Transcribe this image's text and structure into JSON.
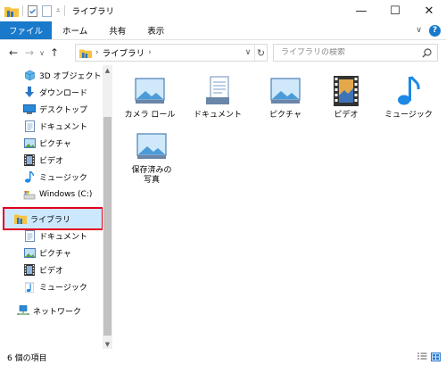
{
  "window": {
    "title": "ライブラリ",
    "minimize": "—",
    "maximize": "☐",
    "close": "✕"
  },
  "ribbon": {
    "tabs": [
      "ファイル",
      "ホーム",
      "共有",
      "表示"
    ],
    "expand": "∨",
    "help": "?"
  },
  "nav": {
    "back": "←",
    "forward": "→",
    "recent": "∨",
    "up": "↑",
    "dropdown": "∨",
    "refresh": "↻"
  },
  "address": {
    "crumb": "ライブラリ",
    "chevron": "›",
    "chevron_end": "›"
  },
  "search": {
    "placeholder": "ライブラリの検索"
  },
  "sidebar": {
    "items": [
      {
        "label": "3D オブジェクト",
        "icon": "3d-objects-icon"
      },
      {
        "label": "ダウンロード",
        "icon": "download-icon"
      },
      {
        "label": "デスクトップ",
        "icon": "desktop-icon"
      },
      {
        "label": "ドキュメント",
        "icon": "documents-icon"
      },
      {
        "label": "ピクチャ",
        "icon": "pictures-icon"
      },
      {
        "label": "ビデオ",
        "icon": "videos-icon"
      },
      {
        "label": "ミュージック",
        "icon": "music-icon"
      },
      {
        "label": "Windows (C:)",
        "icon": "drive-icon"
      },
      {
        "label": "ライブラリ",
        "icon": "library-icon"
      },
      {
        "label": "ドキュメント",
        "icon": "documents-icon"
      },
      {
        "label": "ピクチャ",
        "icon": "pictures-icon"
      },
      {
        "label": "ビデオ",
        "icon": "videos-icon"
      },
      {
        "label": "ミュージック",
        "icon": "music-icon"
      },
      {
        "label": "ネットワーク",
        "icon": "network-icon"
      }
    ],
    "scroll_up": "▲",
    "scroll_down": "▼"
  },
  "libraries": [
    {
      "label": "カメラ ロール",
      "icon": "camera-roll-icon"
    },
    {
      "label": "ドキュメント",
      "icon": "documents-icon"
    },
    {
      "label": "ピクチャ",
      "icon": "pictures-icon"
    },
    {
      "label": "ビデオ",
      "icon": "videos-icon"
    },
    {
      "label": "ミュージック",
      "icon": "music-icon"
    },
    {
      "label": "保存済みの\n写真",
      "icon": "saved-pictures-icon"
    }
  ],
  "status": {
    "count": "6 個の項目"
  },
  "colors": {
    "accent": "#1979ca",
    "selection": "#cce8ff",
    "highlight": "#e1001e",
    "folder": "#f5c342"
  }
}
